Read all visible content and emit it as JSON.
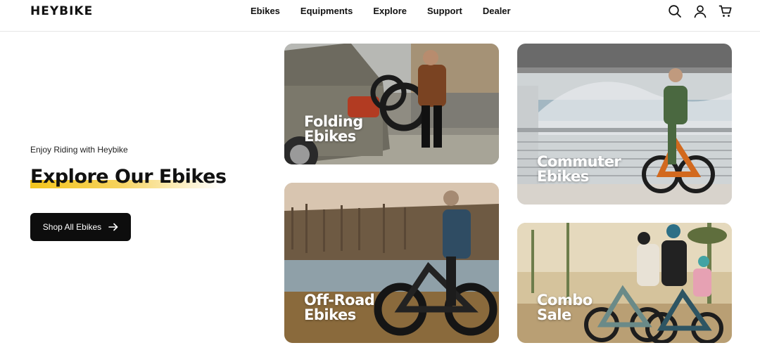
{
  "header": {
    "logo": "HEYBIKE",
    "nav": [
      "Ebikes",
      "Equipments",
      "Explore",
      "Support",
      "Dealer"
    ],
    "icons": [
      "search-icon",
      "account-icon",
      "cart-icon"
    ]
  },
  "hero": {
    "tagline": "Enjoy Riding with Heybike",
    "title": "Explore Our Ebikes",
    "button_label": "Shop All Ebikes",
    "accent_color": "#f3c51d"
  },
  "cards": {
    "folding": {
      "line1": "Folding",
      "line2": "Ebikes"
    },
    "commuter": {
      "line1": "Commuter",
      "line2": "Ebikes"
    },
    "offroad": {
      "line1": "Off-Road",
      "line2": "Ebikes"
    },
    "combo": {
      "line1": "Combo",
      "line2": "Sale"
    }
  }
}
